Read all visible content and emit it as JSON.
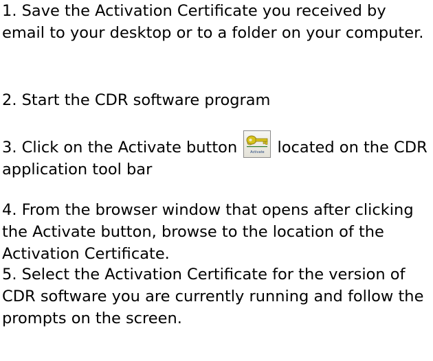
{
  "steps": [
    {
      "text": "1. Save the Activation Certificate you received by email to your desktop or to a folder on your computer."
    },
    {
      "text": "2. Start the CDR software program"
    },
    {
      "before": "3. Click on the Activate button ",
      "after": " located on the CDR application tool bar"
    },
    {
      "text": "4. From the browser window that opens after clicking the Activate button, browse to the location of the Activation Certificate."
    },
    {
      "text": "5. Select the Activation Certificate for the version of CDR software you are currently running and follow the prompts on the screen."
    }
  ],
  "activate_button": {
    "icon": "key-icon",
    "caption": "Activate",
    "key_color": "#d6c21a",
    "accent_color": "#1d3f7a"
  }
}
